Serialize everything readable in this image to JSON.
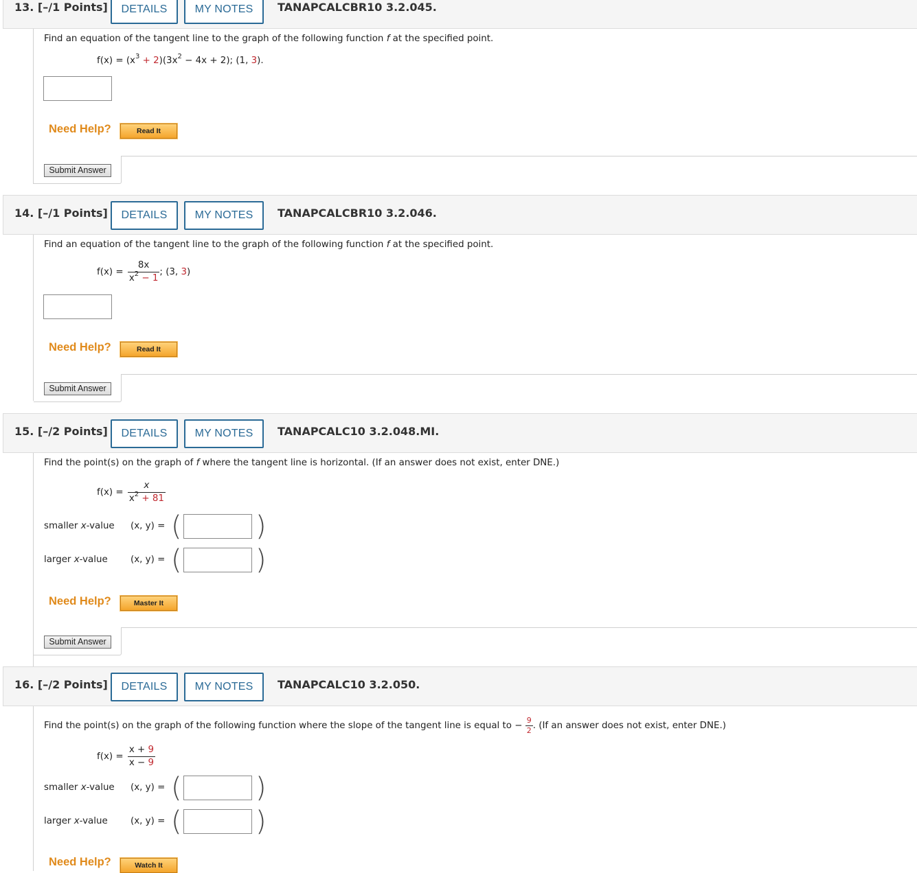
{
  "colors": {
    "accent": "#2a6a96",
    "help": "#e08a1b",
    "red": "#c0282f"
  },
  "q13": {
    "num": "13.  [–/1 Points]",
    "details": "DETAILS",
    "notes": "MY NOTES",
    "code": "TANAPCALCBR10 3.2.045.",
    "prompt": "Find an equation of the tangent line to the graph of the following function",
    "prompt_f": "f",
    "prompt_tail": "at the specified point.",
    "fx": "f(x) = (x",
    "exp3": "3",
    "plus2": "+ 2",
    "mid": ")(3x",
    "exp2": "2",
    "tail1": "− 4x + 2); (1,",
    "pt_y": "3",
    "tail2": ").",
    "need_help": "Need Help?",
    "help_btn": "Read It",
    "submit": "Submit Answer"
  },
  "q14": {
    "num": "14.  [–/1 Points]",
    "details": "DETAILS",
    "notes": "MY NOTES",
    "code": "TANAPCALCBR10 3.2.046.",
    "prompt": "Find an equation of the tangent line to the graph of the following function",
    "prompt_f": "f",
    "prompt_tail": "at the specified point.",
    "fx": "f(x) =",
    "num_expr": "8x",
    "den_a": "x",
    "den_exp": "2",
    "den_b": "− 1",
    "point_a": "; (3,",
    "point_y": "3",
    "point_b": ")",
    "need_help": "Need Help?",
    "help_btn": "Read It",
    "submit": "Submit Answer"
  },
  "q15": {
    "num": "15.  [–/2 Points]",
    "details": "DETAILS",
    "notes": "MY NOTES",
    "code": "TANAPCALC10 3.2.048.MI.",
    "prompt_a": "Find the point(s) on the graph of",
    "prompt_f": "f",
    "prompt_b": "where the tangent line is horizontal. (If an answer does not exist, enter DNE.)",
    "fx": "f(x) =",
    "num_expr": "x",
    "den_a": "x",
    "den_exp": "2",
    "den_b": "+ 81",
    "smaller_label_a": "smaller",
    "smaller_label_x": "x",
    "smaller_label_b": "-value",
    "larger_label_a": "larger",
    "larger_label_x": "x",
    "larger_label_b": "-value",
    "xy": "(x, y)  =",
    "need_help": "Need Help?",
    "help_btn": "Master It",
    "submit": "Submit Answer"
  },
  "q16": {
    "num": "16.  [–/2 Points]",
    "details": "DETAILS",
    "notes": "MY NOTES",
    "code": "TANAPCALC10 3.2.050.",
    "prompt_a": "Find the point(s) on the graph of the following function where the slope of the tangent line is equal to −",
    "slope_num": "9",
    "slope_den": "2",
    "prompt_b": ". (If an answer does not exist, enter DNE.)",
    "fx": "f(x) =",
    "num_a": "x +",
    "num_b": "9",
    "den_a": "x −",
    "den_b": "9",
    "smaller_label_a": "smaller",
    "smaller_label_x": "x",
    "smaller_label_b": "-value",
    "larger_label_a": "larger",
    "larger_label_x": "x",
    "larger_label_b": "-value",
    "xy": "(x, y)  =",
    "need_help": "Need Help?",
    "help_btn": "Watch It"
  }
}
